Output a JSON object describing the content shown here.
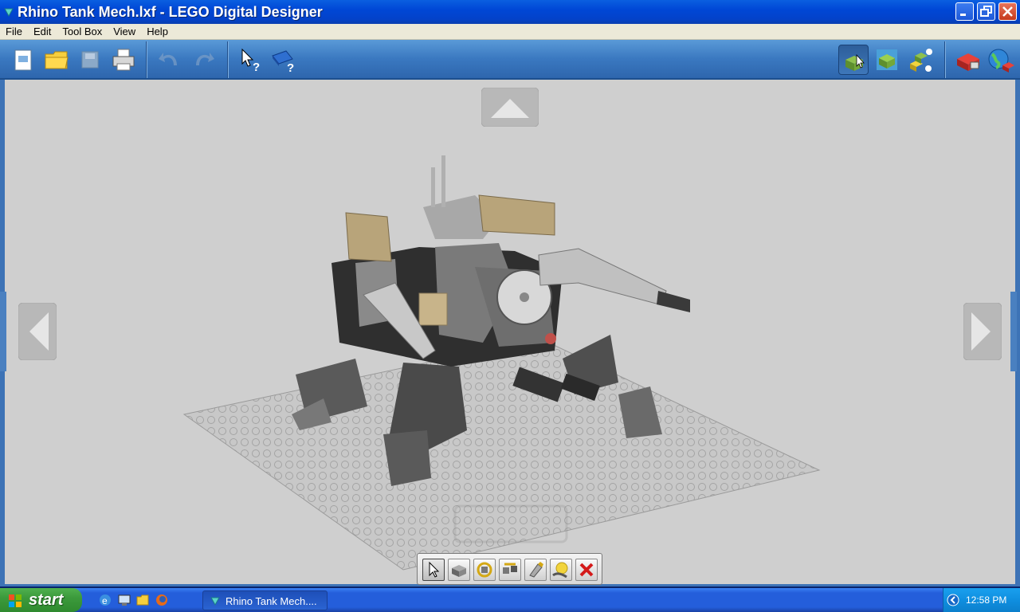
{
  "window": {
    "title": "Rhino Tank Mech.lxf - LEGO Digital Designer"
  },
  "menu": {
    "items": [
      "File",
      "Edit",
      "Tool Box",
      "View",
      "Help"
    ]
  },
  "toolbar": {
    "left_icons": [
      "new-file-icon",
      "open-folder-icon",
      "save-icon",
      "print-icon",
      "undo-icon",
      "redo-icon",
      "help-select-icon",
      "help-book-icon"
    ],
    "right_icons": [
      "build-mode-icon",
      "view-mode-icon",
      "building-guide-mode-icon",
      "shop-icon",
      "online-icon"
    ]
  },
  "palette": {
    "tools": [
      "select-tool-icon",
      "clone-tool-icon",
      "hinge-tool-icon",
      "hinge-align-tool-icon",
      "paint-tool-icon",
      "hide-tool-icon",
      "delete-tool-icon"
    ],
    "active_tool": "select-tool-icon"
  },
  "taskbar": {
    "start_label": "start",
    "task_label": "Rhino Tank Mech....",
    "clock": "12:58 PM"
  },
  "colors": {
    "titlebar": "#0047d6",
    "toolbar": "#3a78c0",
    "canvas": "#cfcfcf",
    "taskbar": "#245edb",
    "start": "#3c9a3c"
  }
}
